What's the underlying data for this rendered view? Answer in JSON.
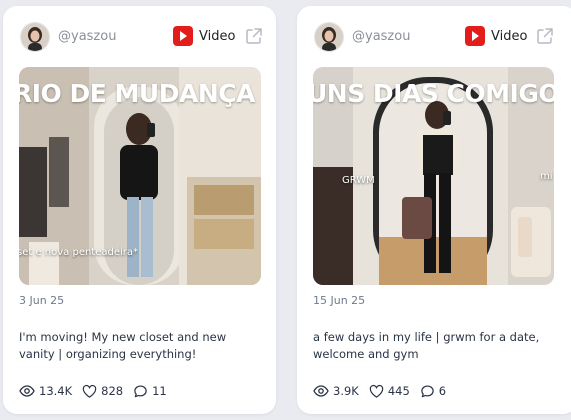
{
  "cards": [
    {
      "username": "@yaszou",
      "type_label": "Video",
      "thumbnail": {
        "overlay_title": "RIO DE MUDANÇA",
        "overlay_caption": "set e nova penteadeira*"
      },
      "date": "3 Jun 25",
      "description": "I'm moving! My new closet and new vanity | organizing everything!",
      "stats": {
        "views": "13.4K",
        "likes": "828",
        "comments": "11"
      }
    },
    {
      "username": "@yaszou",
      "type_label": "Video",
      "thumbnail": {
        "overlay_title": "UNS DIAS COMIGO",
        "overlay_left": "GRWM",
        "overlay_right": "mi"
      },
      "date": "15 Jun 25",
      "description": "a few days in my life | grwm for a date, welcome and gym",
      "stats": {
        "views": "3.9K",
        "likes": "445",
        "comments": "6"
      }
    }
  ],
  "icons": {
    "platform": "youtube-icon",
    "external": "external-link-icon",
    "views": "eye-icon",
    "likes": "heart-icon",
    "comments": "comment-icon"
  },
  "colors": {
    "youtube_red": "#e31c1c",
    "page_bg": "#e9ebf0",
    "card_bg": "#ffffff",
    "muted_text": "#8a8f99",
    "body_text": "#2b3445"
  }
}
